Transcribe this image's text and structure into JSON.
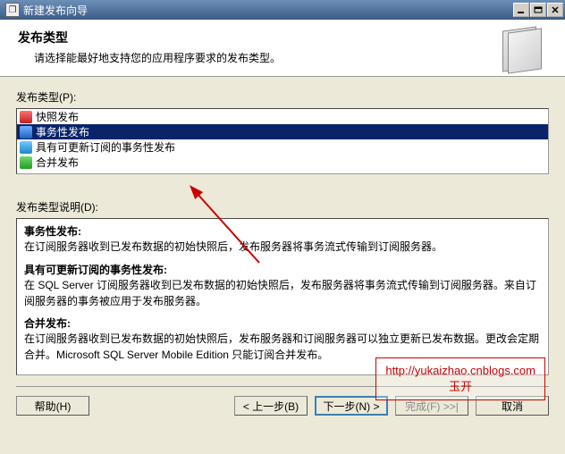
{
  "window": {
    "title": "新建发布向导"
  },
  "header": {
    "title": "发布类型",
    "subtitle": "请选择能最好地支持您的应用程序要求的发布类型。"
  },
  "type_list": {
    "label": "发布类型(P):",
    "items": [
      {
        "label": "快照发布",
        "icon": "ic-red",
        "selected": false
      },
      {
        "label": "事务性发布",
        "icon": "ic-blue",
        "selected": true
      },
      {
        "label": "具有可更新订阅的事务性发布",
        "icon": "ic-blue2",
        "selected": false
      },
      {
        "label": "合并发布",
        "icon": "ic-green",
        "selected": false
      }
    ]
  },
  "description": {
    "label": "发布类型说明(D):",
    "items": [
      {
        "title": "事务性发布:",
        "body": "在订阅服务器收到已发布数据的初始快照后，发布服务器将事务流式传输到订阅服务器。"
      },
      {
        "title": "具有可更新订阅的事务性发布:",
        "body": "在 SQL Server 订阅服务器收到已发布数据的初始快照后，发布服务器将事务流式传输到订阅服务器。来自订阅服务器的事务被应用于发布服务器。"
      },
      {
        "title": "合并发布:",
        "body": "在订阅服务器收到已发布数据的初始快照后，发布服务器和订阅服务器可以独立更新已发布数据。更改会定期合并。Microsoft SQL Server Mobile Edition 只能订阅合并发布。"
      }
    ]
  },
  "watermark": {
    "line1": "http://yukaizhao.cnblogs.com",
    "line2": "玉开"
  },
  "buttons": {
    "help": "帮助(H)",
    "back": "< 上一步(B)",
    "next": "下一步(N) >",
    "finish": "完成(F) >>|",
    "cancel": "取消"
  }
}
